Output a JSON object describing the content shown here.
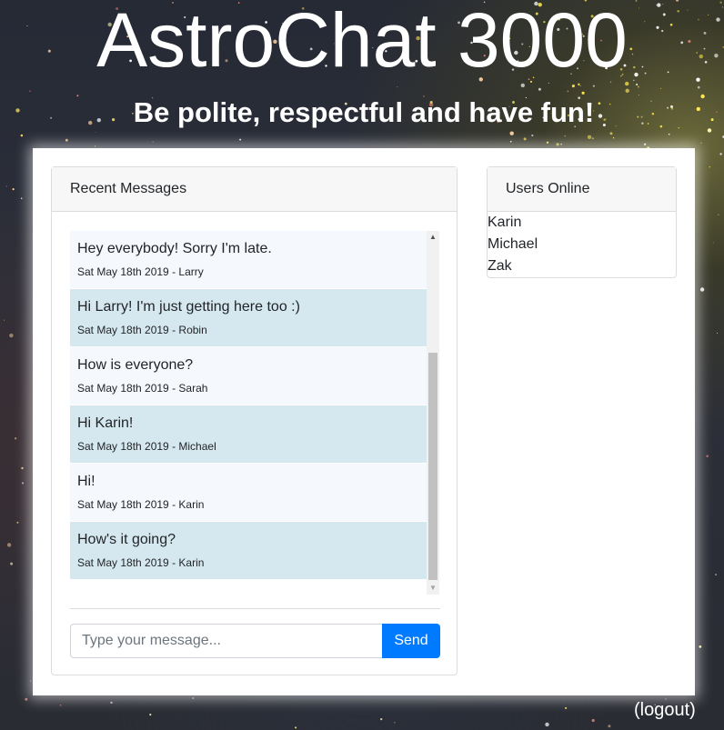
{
  "header": {
    "title": "AstroChat 3000",
    "subtitle": "Be polite, respectful and have fun!"
  },
  "messages_panel": {
    "title": "Recent Messages",
    "messages": [
      {
        "text": "Hey everybody! Sorry I'm late.",
        "meta": "Sat May 18th 2019 - Larry"
      },
      {
        "text": "Hi Larry! I'm just getting here too :)",
        "meta": "Sat May 18th 2019 - Robin"
      },
      {
        "text": "How is everyone?",
        "meta": "Sat May 18th 2019 - Sarah"
      },
      {
        "text": "Hi Karin!",
        "meta": "Sat May 18th 2019 - Michael"
      },
      {
        "text": "Hi!",
        "meta": "Sat May 18th 2019 - Karin"
      },
      {
        "text": "How's it going?",
        "meta": "Sat May 18th 2019 - Karin"
      }
    ],
    "input_placeholder": "Type your message...",
    "input_value": "",
    "send_label": "Send"
  },
  "users_panel": {
    "title": "Users Online",
    "users": [
      "Karin",
      "Michael",
      "Zak"
    ]
  },
  "footer": {
    "logout_label": "(logout)"
  },
  "colors": {
    "accent": "#007bff",
    "message_alt_bg": "#d6e8ef",
    "message_bg": "#f5f8fc"
  },
  "icons": {
    "scroll_up": "scroll-up-arrow-icon",
    "scroll_down": "scroll-down-arrow-icon"
  }
}
